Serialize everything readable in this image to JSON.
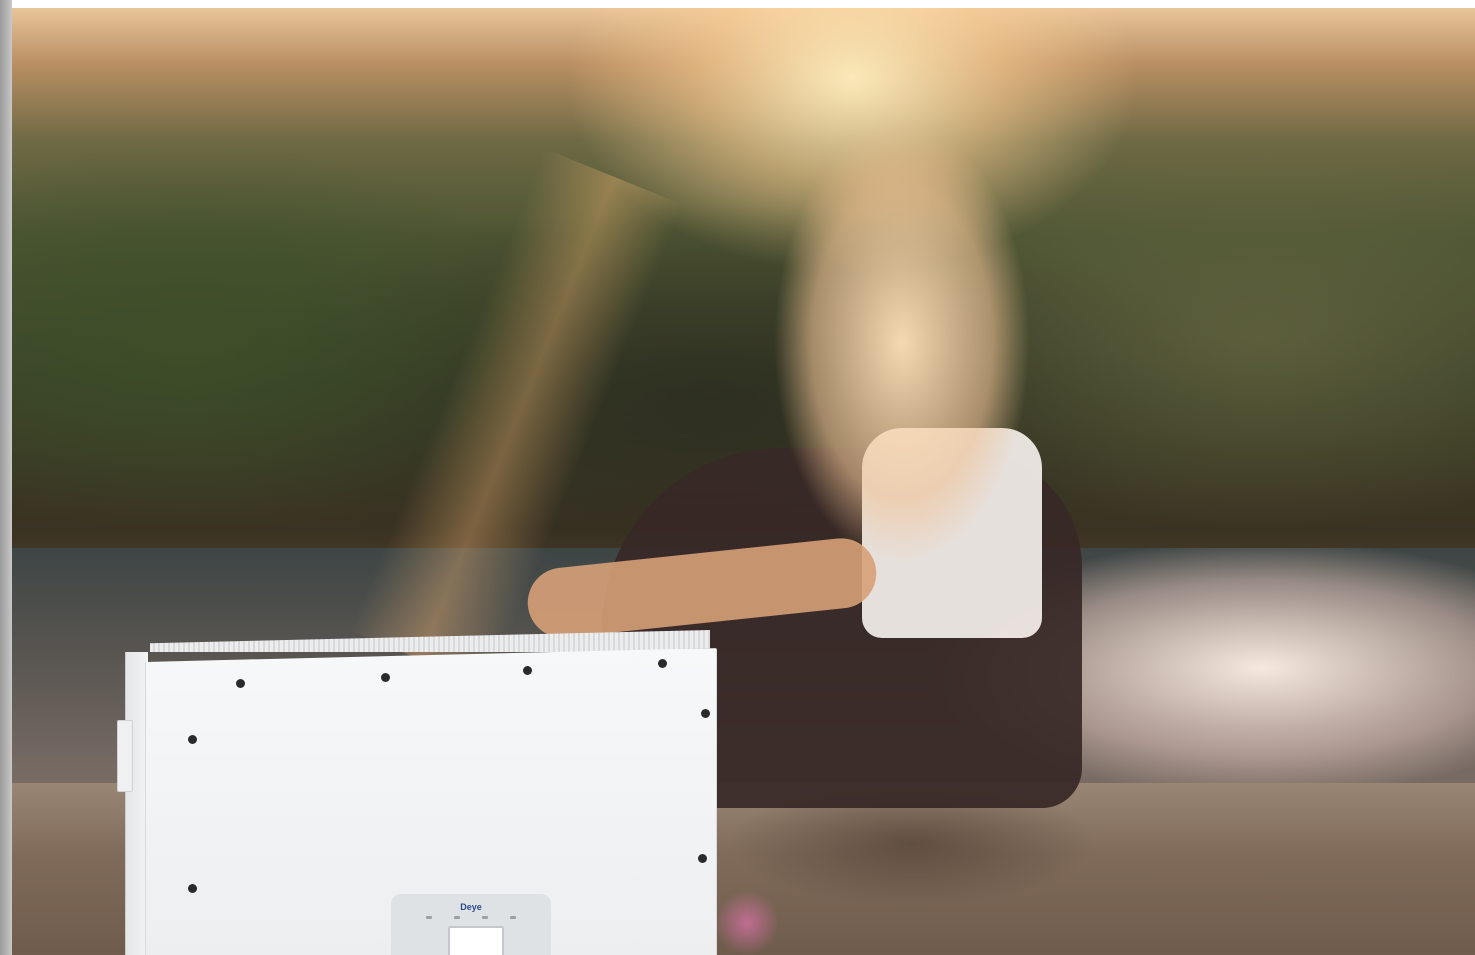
{
  "scene": {
    "description_hidden": "",
    "colors": {
      "border": "#b0b0b0",
      "sunlight": "#ffe7b5",
      "forest": "#3c4128",
      "ground": "#806b5a",
      "inverter": "#f2f3f4"
    }
  },
  "inverter": {
    "brand_label": "Deye",
    "icons": [
      "led-indicator",
      "display-screen",
      "control-key"
    ]
  }
}
